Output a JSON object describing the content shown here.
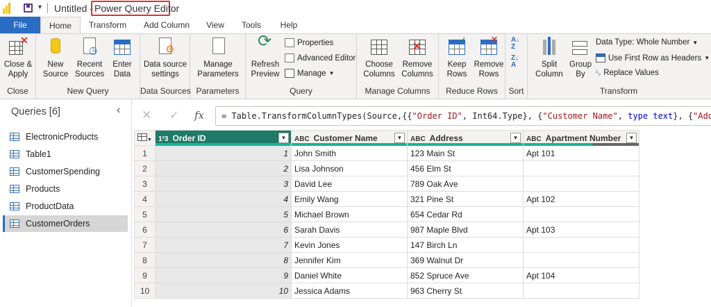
{
  "window": {
    "title_doc": "Untitled -",
    "title_app": "Power Query Editor"
  },
  "tabs": [
    "File",
    "Home",
    "Transform",
    "Add Column",
    "View",
    "Tools",
    "Help"
  ],
  "ribbon": {
    "close_group": {
      "label": "Close",
      "close_apply": "Close &",
      "close_apply2": "Apply"
    },
    "new_query_group": {
      "label": "New Query",
      "new_source": "New",
      "new_source2": "Source",
      "recent_sources": "Recent",
      "recent_sources2": "Sources",
      "enter_data": "Enter",
      "enter_data2": "Data"
    },
    "data_sources_group": {
      "label": "Data Sources",
      "settings": "Data source",
      "settings2": "settings"
    },
    "parameters_group": {
      "label": "Parameters",
      "manage": "Manage",
      "manage2": "Parameters"
    },
    "query_group": {
      "label": "Query",
      "refresh": "Refresh",
      "refresh2": "Preview",
      "properties": "Properties",
      "advanced_editor": "Advanced Editor",
      "manage": "Manage"
    },
    "manage_columns_group": {
      "label": "Manage Columns",
      "choose": "Choose",
      "choose2": "Columns",
      "remove": "Remove",
      "remove2": "Columns"
    },
    "reduce_rows_group": {
      "label": "Reduce Rows",
      "keep": "Keep",
      "keep2": "Rows",
      "remove": "Remove",
      "remove2": "Rows"
    },
    "sort_group": {
      "label": "Sort"
    },
    "transform_group": {
      "label": "Transform",
      "split": "Split",
      "split2": "Column",
      "group": "Group",
      "group2": "By",
      "data_type": "Data Type: Whole Number",
      "first_row": "Use First Row as Headers",
      "replace": "Replace Values"
    }
  },
  "queries_pane": {
    "title": "Queries [6]",
    "items": [
      "ElectronicProducts",
      "Table1",
      "CustomerSpending",
      "Products",
      "ProductData",
      "CustomerOrders"
    ]
  },
  "formula": {
    "prefix": "= Table.TransformColumnTypes(Source,{{",
    "s1": "\"Order ID\"",
    "p2": ", Int64.Type}, {",
    "s2": "\"Customer Name\"",
    "p3": ", ",
    "t1": "type text",
    "p4": "}, {",
    "s3": "\"Address"
  },
  "table": {
    "columns": [
      {
        "label": "Order ID",
        "type_icon": "1²3"
      },
      {
        "label": "Customer Name",
        "type_icon": "ABC"
      },
      {
        "label": "Address",
        "type_icon": "ABC"
      },
      {
        "label": "Apartment Number",
        "type_icon": "ABC"
      }
    ],
    "rows": [
      [
        "1",
        "1",
        "John Smith",
        "123 Main St",
        "Apt 101"
      ],
      [
        "2",
        "2",
        "Lisa Johnson",
        "456 Elm St",
        ""
      ],
      [
        "3",
        "3",
        "David Lee",
        "789 Oak Ave",
        ""
      ],
      [
        "4",
        "4",
        "Emily Wang",
        "321 Pine St",
        "Apt 102"
      ],
      [
        "5",
        "5",
        "Michael Brown",
        "654 Cedar Rd",
        ""
      ],
      [
        "6",
        "6",
        "Sarah Davis",
        "987 Maple Blvd",
        "Apt 103"
      ],
      [
        "7",
        "7",
        "Kevin Jones",
        "147 Birch Ln",
        ""
      ],
      [
        "8",
        "8",
        "Jennifer Kim",
        "369 Walnut Dr",
        ""
      ],
      [
        "9",
        "9",
        "Daniel White",
        "852 Spruce Ave",
        "Apt 104"
      ],
      [
        "10",
        "10",
        "Jessica Adams",
        "963 Cherry St",
        ""
      ]
    ]
  },
  "colors": {
    "accent": "#2b6cc4",
    "header_selected": "#1f7a68",
    "quality_bar": "#19b39a",
    "highlight_box": "#d9342b"
  }
}
